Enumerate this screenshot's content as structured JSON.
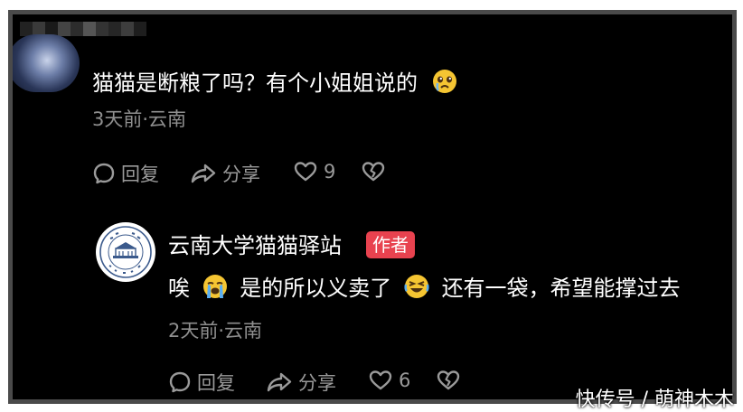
{
  "comment": {
    "text": "猫猫是断粮了吗？有个小姐姐说的",
    "meta": "3天前·云南",
    "actions": {
      "reply": "回复",
      "share": "分享",
      "likes": "9"
    }
  },
  "reply": {
    "author": "云南大学猫猫驿站",
    "badge": "作者",
    "text_part1": "唉",
    "text_part2": "是的所以义卖了",
    "text_part3": "还有一袋，希望能撑过去",
    "meta": "2天前·云南",
    "actions": {
      "reply": "回复",
      "share": "分享",
      "likes": "6"
    }
  },
  "watermark": "快传号 / 萌神木木",
  "colors": {
    "background": "#000000",
    "badge": "#e8424f",
    "secondary_text": "#8f8f8f"
  }
}
